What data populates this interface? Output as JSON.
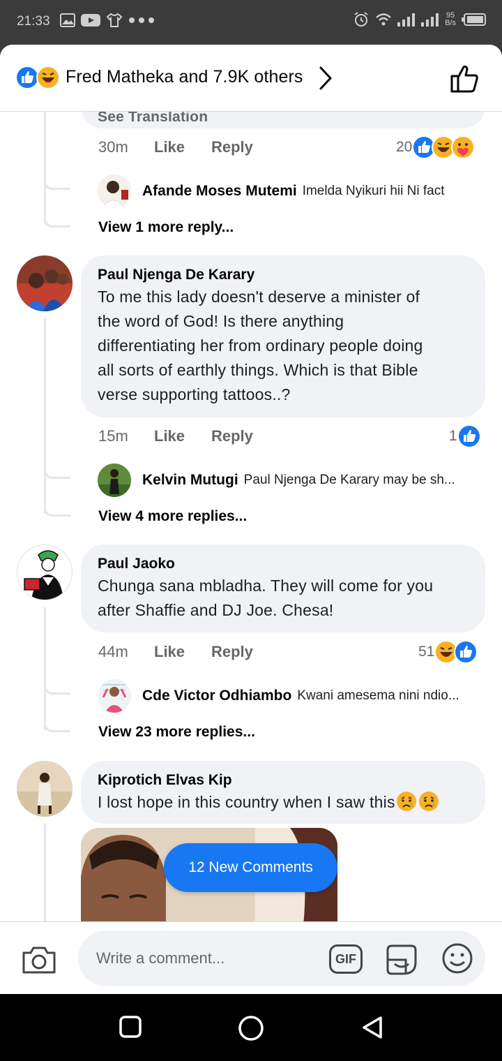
{
  "status_bar": {
    "time": "21:33",
    "net_speed_value": "95",
    "net_speed_unit": "B/s"
  },
  "header": {
    "reactions": [
      "like-icon",
      "haha-icon"
    ],
    "title": "Fred Matheka and 7.9K others",
    "chevron": "chevron-right-icon",
    "like_button_icon": "thumbs-up-outline-icon"
  },
  "partial_top": {
    "see_translation": "See Translation",
    "time": "30m",
    "like": "Like",
    "reply": "Reply",
    "reaction_count": "20",
    "reactions": [
      "like-icon",
      "haha-icon",
      "care-icon"
    ],
    "reply_preview": {
      "name": "Afande Moses Mutemi",
      "text": "Imelda Nyikuri hii Ni fact"
    },
    "view_more": "View 1 more reply..."
  },
  "comments": [
    {
      "name": "Paul Njenga De Karary",
      "lines": [
        "To me this lady doesn't deserve a minister of",
        "the word of God! Is there anything",
        "differentiating her from ordinary people doing",
        "all sorts of earthly things. Which is that Bible",
        "verse supporting tattoos..?"
      ],
      "time": "15m",
      "like": "Like",
      "reply": "Reply",
      "reaction_count": "1",
      "reactions": [
        "like-icon"
      ],
      "reply_preview": {
        "name": "Kelvin Mutugi",
        "text": "Paul Njenga De Karary may be sh..."
      },
      "view_more": "View 4 more replies..."
    },
    {
      "name": "Paul Jaoko",
      "lines": [
        "Chunga sana mbladha. They will come for you",
        "after Shaffie and DJ Joe. Chesa!"
      ],
      "time": "44m",
      "like": "Like",
      "reply": "Reply",
      "reaction_count": "51",
      "reactions": [
        "haha-icon",
        "like-icon"
      ],
      "reply_preview": {
        "name": "Cde Victor Odhiambo",
        "text": "Kwani amesema nini ndio..."
      },
      "view_more": "View 23 more replies..."
    },
    {
      "name": "Kiprotich Elvas Kip",
      "lines": [
        "I lost hope in this country when I saw this"
      ],
      "emoji": [
        "sad-tear-emoji",
        "sad-tear-emoji"
      ]
    }
  ],
  "new_comments_button": "12 New Comments",
  "composer": {
    "placeholder": "Write a comment...",
    "gif_label": "GIF"
  },
  "colors": {
    "accent": "#1877f2",
    "bubble": "#f0f2f5",
    "secondary_text": "#65676b",
    "haha": "#f7b125"
  }
}
